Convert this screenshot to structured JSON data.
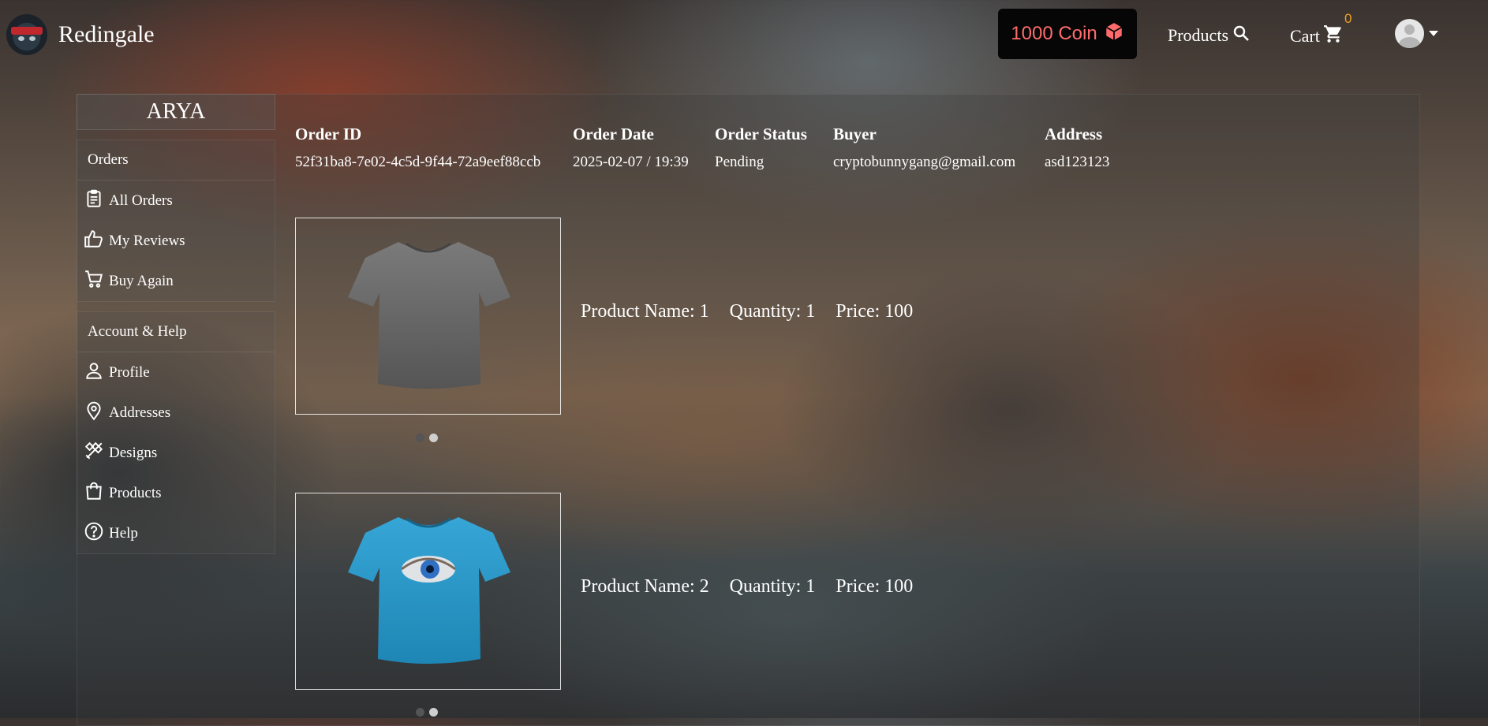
{
  "brand": {
    "name": "Redingale"
  },
  "nav": {
    "coin_label": "1000 Coin",
    "products_label": "Products",
    "cart_label": "Cart",
    "cart_count": "0"
  },
  "sidebar": {
    "user_name": "ARYA",
    "orders_heading": "Orders",
    "orders_items": [
      {
        "label": "All Orders",
        "icon": "clipboard-icon"
      },
      {
        "label": "My Reviews",
        "icon": "thumbs-up-icon"
      },
      {
        "label": "Buy Again",
        "icon": "cart-icon"
      }
    ],
    "account_heading": "Account & Help",
    "account_items": [
      {
        "label": "Profile",
        "icon": "person-icon"
      },
      {
        "label": "Addresses",
        "icon": "location-pin-icon"
      },
      {
        "label": "Designs",
        "icon": "design-tools-icon"
      },
      {
        "label": "Products",
        "icon": "shopping-bag-icon"
      },
      {
        "label": "Help",
        "icon": "help-circle-icon"
      }
    ]
  },
  "order": {
    "headers": {
      "id": "Order ID",
      "date": "Order Date",
      "status": "Order Status",
      "buyer": "Buyer",
      "address": "Address"
    },
    "id": "52f31ba8-7e02-4c5d-9f44-72a9eef88ccb",
    "date": "2025-02-07 / 19:39",
    "status": "Pending",
    "buyer": "cryptobunnygang@gmail.com",
    "address": "asd123123"
  },
  "products": [
    {
      "name_label": "Product Name: 1",
      "quantity_label": "Quantity: 1",
      "price_label": "Price: 100",
      "shirt_color": "#6b6b6b"
    },
    {
      "name_label": "Product Name: 2",
      "quantity_label": "Quantity: 1",
      "price_label": "Price: 100",
      "shirt_color": "#2b9bcc"
    }
  ],
  "colors": {
    "coin_text": "#ff6b6b",
    "cart_count": "#f0a020"
  }
}
